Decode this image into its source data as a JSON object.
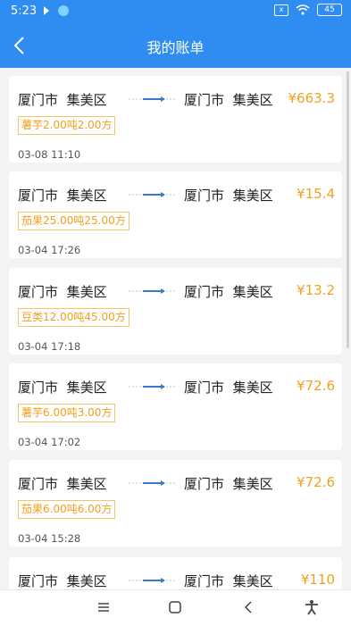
{
  "status_bar": {
    "time": "5:23",
    "sim_label": "x",
    "battery": "45"
  },
  "header": {
    "title": "我的账单"
  },
  "bills": [
    {
      "origin_city": "厦门市",
      "origin_district": "集美区",
      "dest_city": "厦门市",
      "dest_district": "集美区",
      "price": "¥663.3",
      "cargo": "薯芋2.00吨2.00方",
      "time": "03-08 11:10"
    },
    {
      "origin_city": "厦门市",
      "origin_district": "集美区",
      "dest_city": "厦门市",
      "dest_district": "集美区",
      "price": "¥15.4",
      "cargo": "茄果25.00吨25.00方",
      "time": "03-04 17:26"
    },
    {
      "origin_city": "厦门市",
      "origin_district": "集美区",
      "dest_city": "厦门市",
      "dest_district": "集美区",
      "price": "¥13.2",
      "cargo": "豆类12.00吨45.00方",
      "time": "03-04 17:18"
    },
    {
      "origin_city": "厦门市",
      "origin_district": "集美区",
      "dest_city": "厦门市",
      "dest_district": "集美区",
      "price": "¥72.6",
      "cargo": "薯芋6.00吨3.00方",
      "time": "03-04 17:02"
    },
    {
      "origin_city": "厦门市",
      "origin_district": "集美区",
      "dest_city": "厦门市",
      "dest_district": "集美区",
      "price": "¥72.6",
      "cargo": "茄果6.00吨6.00方",
      "time": "03-04 15:28"
    },
    {
      "origin_city": "厦门市",
      "origin_district": "集美区",
      "dest_city": "厦门市",
      "dest_district": "集美区",
      "price": "¥110",
      "cargo": "",
      "time": ""
    }
  ],
  "colors": {
    "header_blue": "#2f8cf0",
    "price_orange": "#f0a020"
  },
  "icons": {
    "back": "chevron-left-icon",
    "route_arrow": "arrow-right-icon",
    "nav_menu": "menu-icon",
    "nav_home": "home-icon",
    "nav_back": "back-icon",
    "nav_accessibility": "accessibility-icon"
  }
}
